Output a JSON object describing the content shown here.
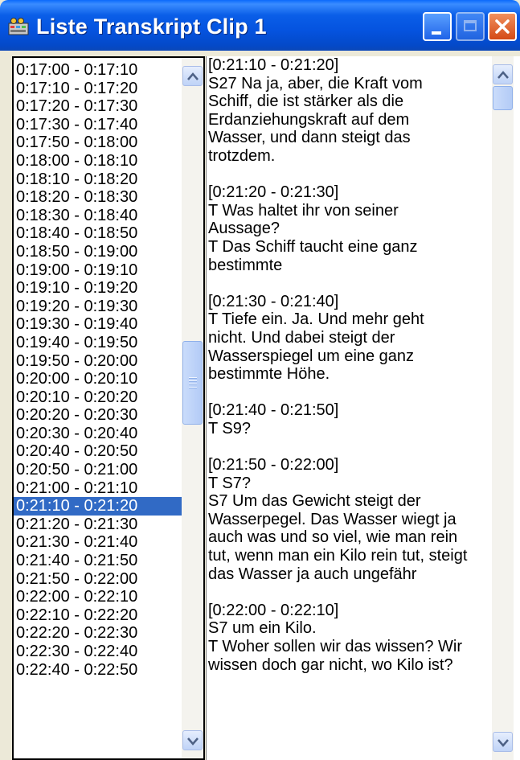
{
  "window": {
    "title": "Liste Transkript Clip 1"
  },
  "list": {
    "selected_index": 19,
    "items": [
      "0:17:00 - 0:17:10",
      "0:17:10 - 0:17:20",
      "0:17:20 - 0:17:30",
      "0:17:30 - 0:17:40",
      "0:17:50 - 0:18:00",
      "0:18:00 - 0:18:10",
      "0:18:10 - 0:18:20",
      "0:18:20 - 0:18:30",
      "0:18:30 - 0:18:40",
      "0:18:40 - 0:18:50",
      "0:18:50 - 0:19:00",
      "0:19:00 - 0:19:10",
      "0:19:10 - 0:19:20",
      "0:19:20 - 0:19:30",
      "0:19:30 - 0:19:40",
      "0:19:40 - 0:19:50",
      "0:19:50 - 0:20:00",
      "0:20:00 - 0:20:10",
      "0:20:10 - 0:20:20",
      "0:20:20 - 0:20:30",
      "0:20:30 - 0:20:40",
      "0:20:40 - 0:20:50",
      "0:20:50 - 0:21:00",
      "0:21:00 - 0:21:10",
      "0:21:10 - 0:21:20",
      "0:21:20 - 0:21:30",
      "0:21:30 - 0:21:40",
      "0:21:40 - 0:21:50",
      "0:21:50 - 0:22:00",
      "0:22:00 - 0:22:10",
      "0:22:10 - 0:22:20",
      "0:22:20 - 0:22:30",
      "0:22:30 - 0:22:40",
      "0:22:40 - 0:22:50"
    ]
  },
  "transcript": {
    "lines": [
      "[0:21:10 - 0:21:20]",
      "S27 Na ja, aber, die Kraft vom",
      "Schiff, die ist stärker als die",
      "Erdanziehungskraft auf dem",
      "Wasser, und dann steigt das",
      "trotzdem.",
      "",
      "[0:21:20 - 0:21:30]",
      "T Was haltet ihr von seiner",
      "Aussage?",
      "T Das Schiff taucht eine ganz",
      "bestimmte",
      "",
      "[0:21:30 - 0:21:40]",
      "T Tiefe ein. Ja. Und mehr geht",
      "nicht. Und dabei steigt der",
      "Wasserspiegel um eine ganz",
      "bestimmte Höhe.",
      "",
      "[0:21:40 - 0:21:50]",
      "T S9?",
      "",
      "[0:21:50 - 0:22:00]",
      "T S7?",
      "S7 Um das Gewicht steigt der",
      "Wasserpegel. Das Wasser wiegt ja",
      "auch was und so viel, wie man rein",
      "tut, wenn man ein Kilo rein tut, steigt",
      "das Wasser ja auch ungefähr",
      "",
      "[0:22:00 - 0:22:10]",
      "S7  um ein Kilo.",
      "T Woher sollen wir das wissen? Wir",
      "wissen doch gar nicht, wo Kilo ist?"
    ]
  },
  "colors": {
    "titlebar": "#0553df",
    "selection": "#316ac5",
    "close_button": "#d44a16"
  },
  "icons": {
    "app": "film-camera-icon",
    "minimize": "minimize-icon",
    "maximize": "maximize-icon",
    "close": "close-icon"
  }
}
